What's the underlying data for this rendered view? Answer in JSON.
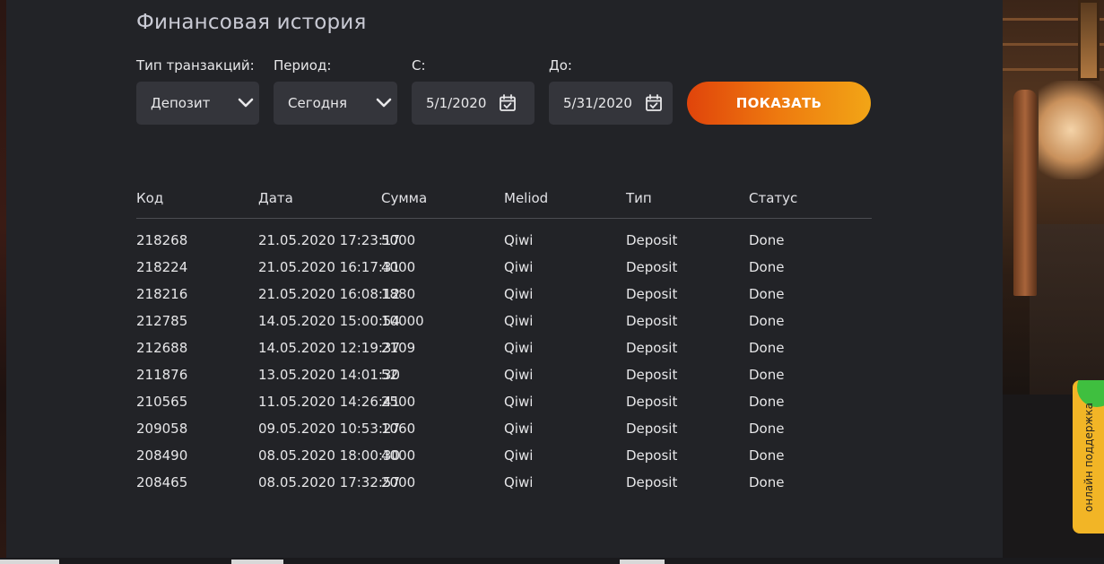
{
  "page": {
    "title": "Финансовая история"
  },
  "filters": {
    "type_label": "Тип транзакций:",
    "type_value": "Депозит",
    "period_label": "Период:",
    "period_value": "Сегодня",
    "from_label": "С:",
    "from_value": "5/1/2020",
    "to_label": "До:",
    "to_value": "5/31/2020",
    "show_button": "ПОКАЗАТЬ"
  },
  "table": {
    "headers": [
      "Код",
      "Дата",
      "Сумма",
      "Meliod",
      "Тип",
      "Статус"
    ],
    "rows": [
      [
        "218268",
        "21.05.2020 17:23:17",
        "5000",
        "Qiwi",
        "Deposit",
        "Done"
      ],
      [
        "218224",
        "21.05.2020 16:17:31",
        "4000",
        "Qiwi",
        "Deposit",
        "Done"
      ],
      [
        "218216",
        "21.05.2020 16:08:12",
        "1880",
        "Qiwi",
        "Deposit",
        "Done"
      ],
      [
        "212785",
        "14.05.2020 15:00:54",
        "10000",
        "Qiwi",
        "Deposit",
        "Done"
      ],
      [
        "212688",
        "14.05.2020 12:19:37",
        "2109",
        "Qiwi",
        "Deposit",
        "Done"
      ],
      [
        "211876",
        "13.05.2020 14:01:30",
        "52",
        "Qiwi",
        "Deposit",
        "Done"
      ],
      [
        "210565",
        "11.05.2020 14:26:41",
        "2500",
        "Qiwi",
        "Deposit",
        "Done"
      ],
      [
        "209058",
        "09.05.2020 10:53:27",
        "1060",
        "Qiwi",
        "Deposit",
        "Done"
      ],
      [
        "208490",
        "08.05.2020 18:00:30",
        "4000",
        "Qiwi",
        "Deposit",
        "Done"
      ],
      [
        "208465",
        "08.05.2020 17:32:57",
        "2000",
        "Qiwi",
        "Deposit",
        "Done"
      ]
    ]
  },
  "support": {
    "label": "онлайн поддержка"
  },
  "icons": {
    "dropdown": "chevron-down-icon",
    "date": "calendar-check-icon"
  },
  "colors": {
    "background": "#222327",
    "field": "#34353b",
    "accent_start": "#e0440b",
    "accent_end": "#f2a516",
    "support": "#f2b526",
    "support_dot": "#3fbf3f"
  }
}
